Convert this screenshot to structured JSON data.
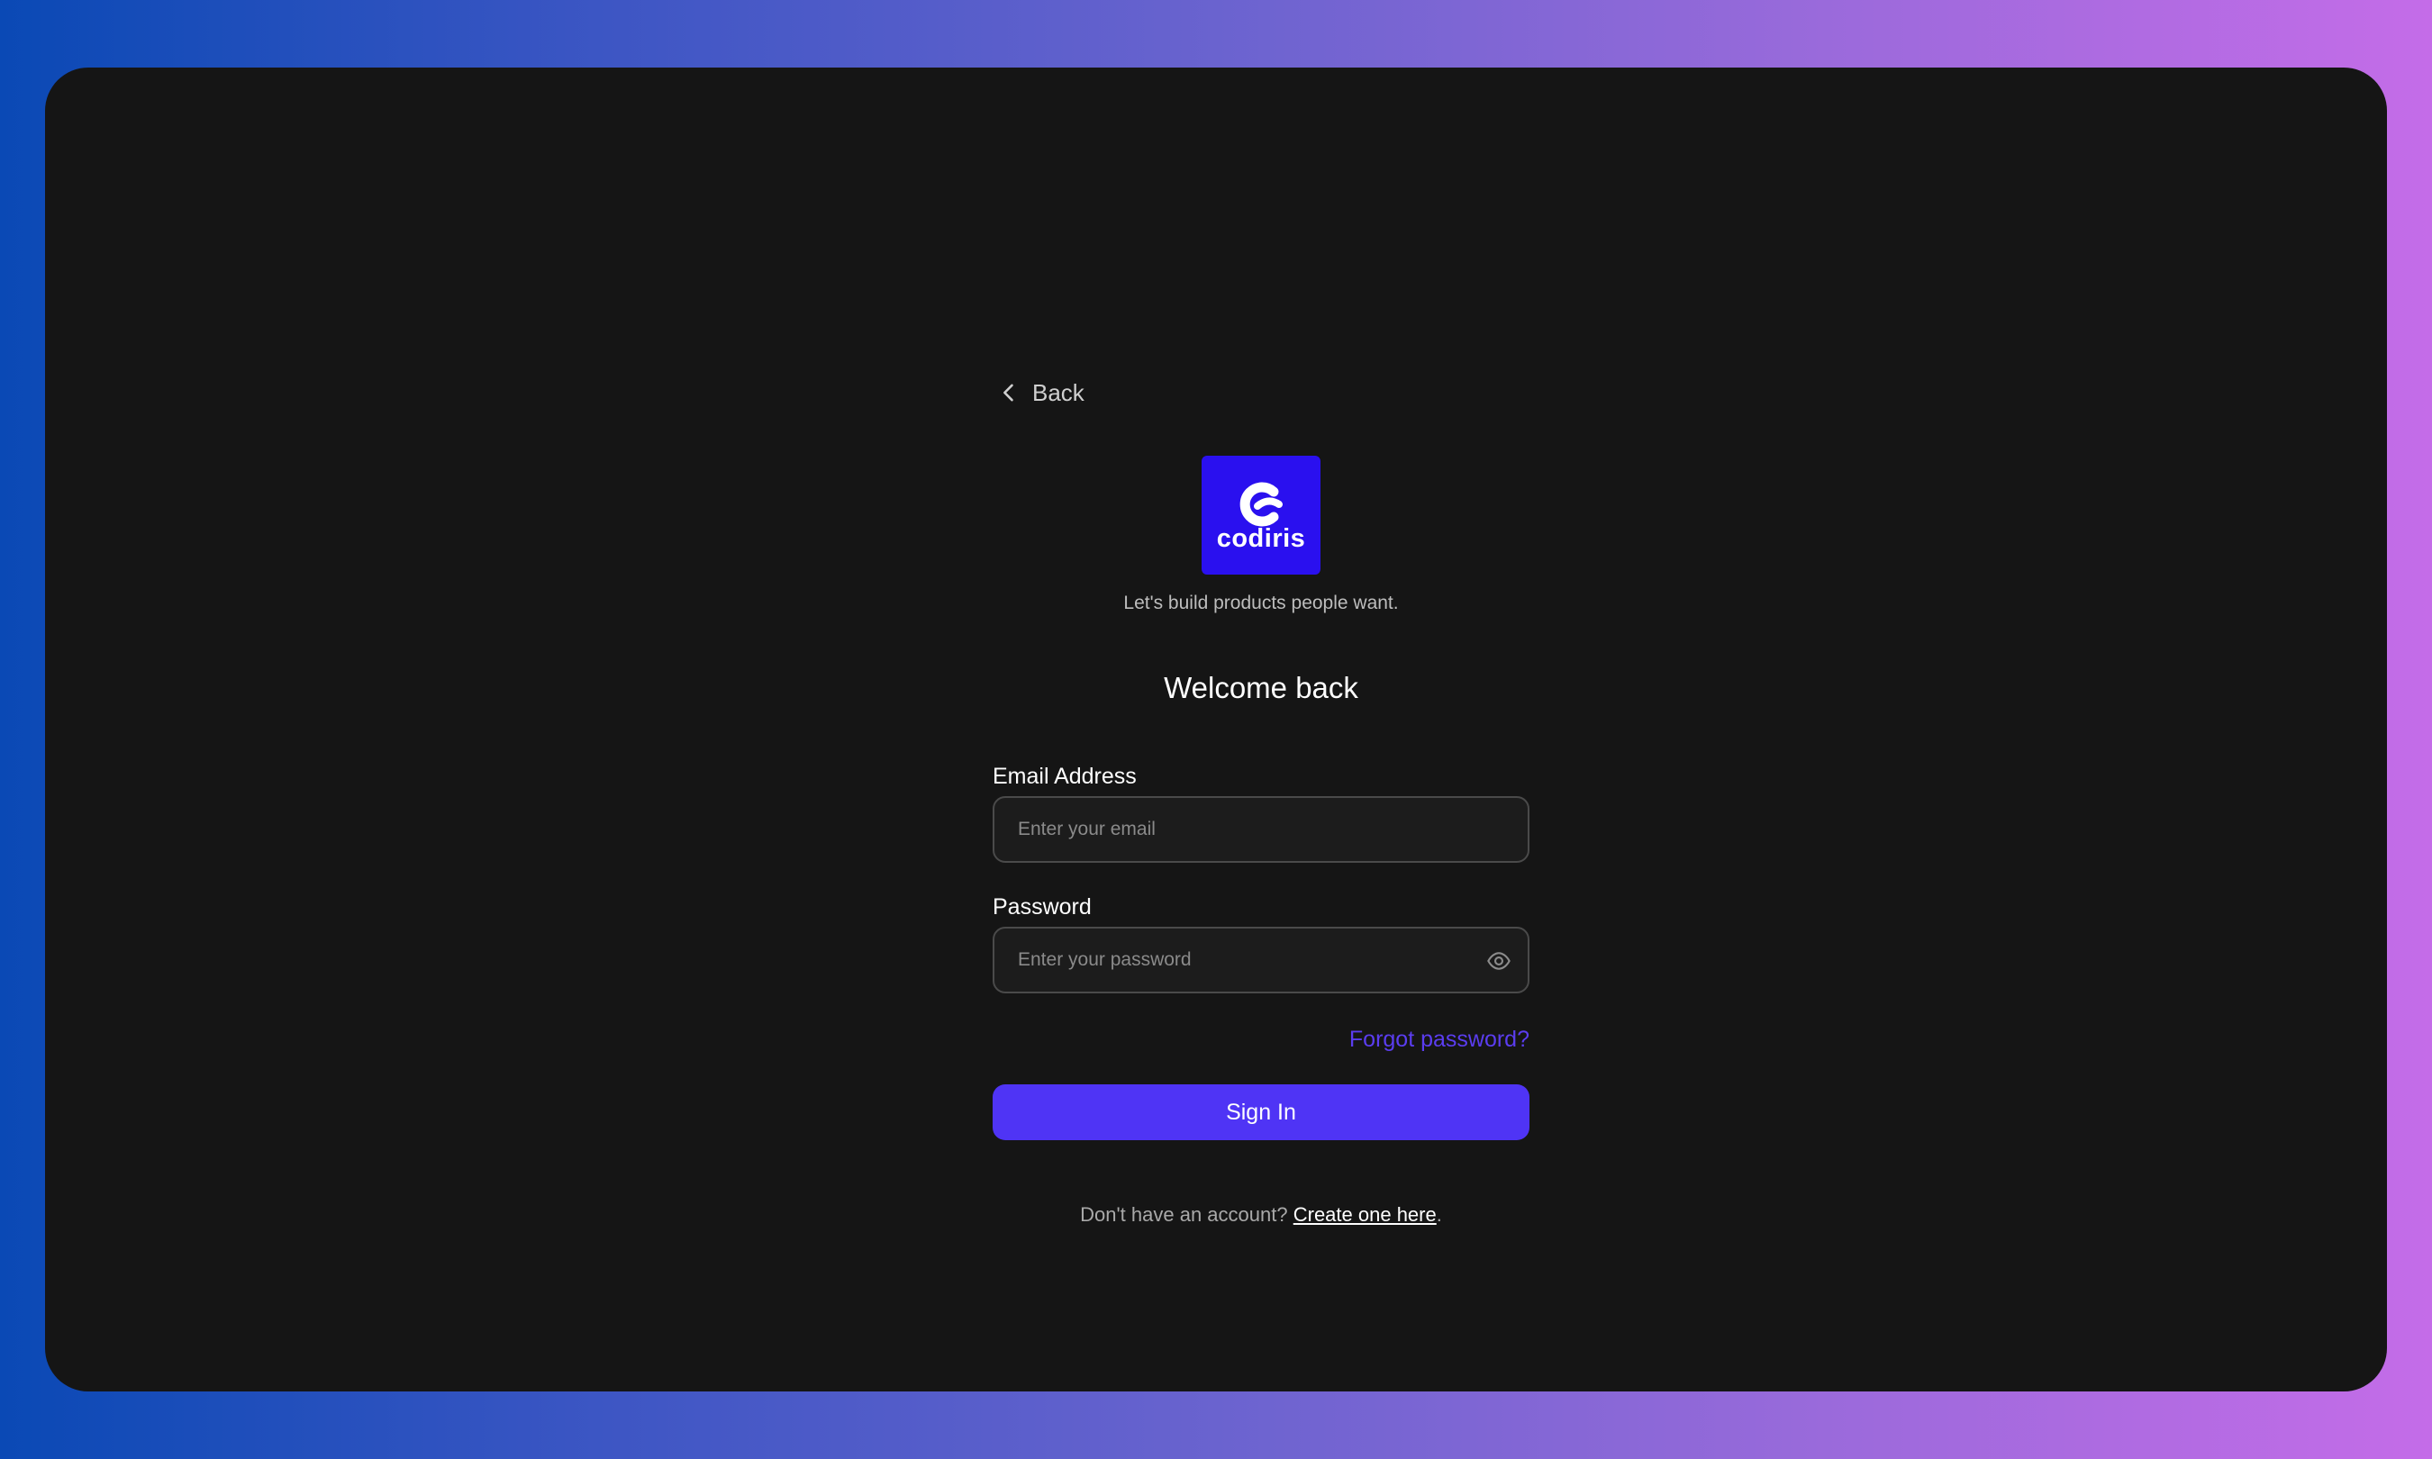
{
  "nav": {
    "back_label": "Back",
    "back_icon": "chevron-left-icon"
  },
  "brand": {
    "logo_icon": "codiris-logo-icon",
    "name": "codiris",
    "tagline": "Let's build products people want.",
    "color": "#2a10ef"
  },
  "form": {
    "heading": "Welcome back",
    "email": {
      "label": "Email Address",
      "value": "",
      "placeholder": "Enter your email"
    },
    "password": {
      "label": "Password",
      "value": "",
      "placeholder": "Enter your password",
      "toggle_icon": "eye-icon"
    },
    "forgot_label": "Forgot password?",
    "submit_label": "Sign In",
    "accent_color": "#4f34f5"
  },
  "footer": {
    "prompt": "Don't have an account?",
    "link_label": "Create one here",
    "suffix": "."
  }
}
